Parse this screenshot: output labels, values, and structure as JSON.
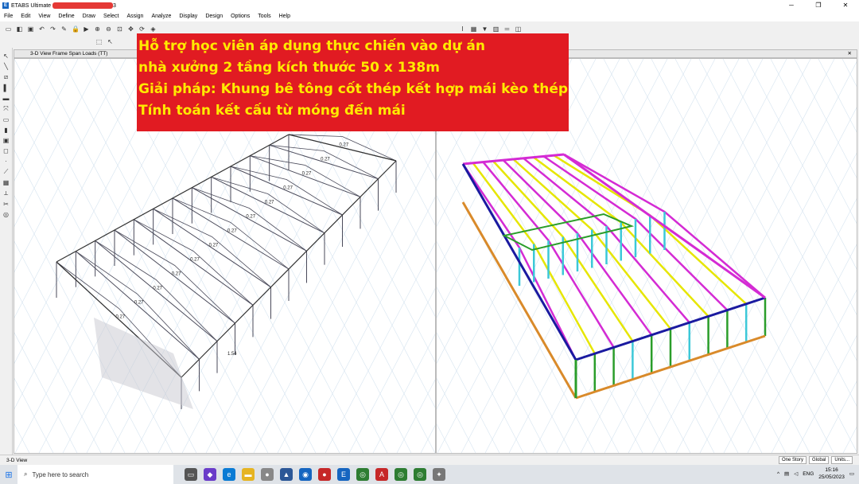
{
  "app": {
    "title": "ETABS Ultimate",
    "title_suffix": "3"
  },
  "menu": [
    "File",
    "Edit",
    "View",
    "Define",
    "Draw",
    "Select",
    "Assign",
    "Analyze",
    "Display",
    "Design",
    "Options",
    "Tools",
    "Help"
  ],
  "left_view": {
    "title": "3-D View  Frame Span Loads (TT)"
  },
  "banner": {
    "line1": "Hỗ trợ học viên áp dụng thực chiến vào dự án",
    "line2": "nhà xưởng 2 tầng kích thước 50 x 138m",
    "line3": " Giải pháp: Khung bê tông cốt thép kết hợp mái kèo thép",
    "line4": " Tính toán kết cấu từ móng đến mái"
  },
  "load_labels": [
    "0.27",
    "1.54"
  ],
  "status": {
    "left": "3-D View",
    "story": "One Story",
    "coord": "Global",
    "units": "Units..."
  },
  "taskbar": {
    "search_placeholder": "Type here to search",
    "lang": "ENG",
    "time": "15:16",
    "date": "25/05/2023"
  },
  "colors": {
    "banner_bg": "#e11b22",
    "banner_text": "#ffea00",
    "magenta": "#d42bd4",
    "yellow": "#e6e600",
    "cyan": "#3cc8d8",
    "blue": "#1a1aa0",
    "orange": "#d98a2a",
    "green": "#2a9d2a"
  }
}
